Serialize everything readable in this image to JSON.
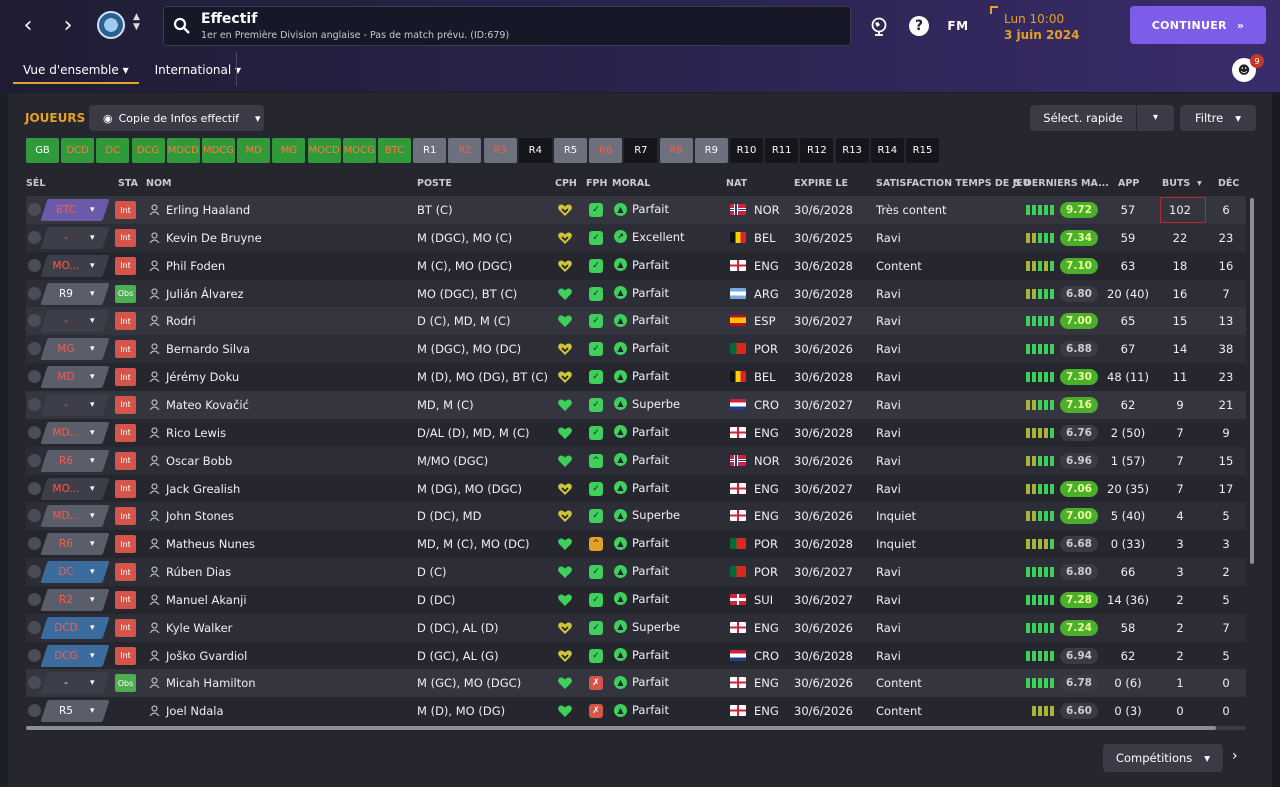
{
  "header": {
    "title": "Effectif",
    "subtitle": "1er en Première Division anglaise - Pas de match prévu. (ID:679)",
    "date_line1": "Lun 10:00",
    "date_line2": "3 juin 2024",
    "continue_label": "CONTINUER",
    "fm_label": "FM",
    "help_label": "?",
    "notif_count": "9",
    "tabs": [
      {
        "label": "Vue d'ensemble"
      },
      {
        "label": "International"
      }
    ]
  },
  "toolbar": {
    "section_label": "JOUEURS",
    "view_label": "Copie de Infos effectif",
    "quick_select": "Sélect. rapide",
    "filter": "Filtre"
  },
  "chips": [
    {
      "label": "GB",
      "style": "g"
    },
    {
      "label": "DCD",
      "style": "g o"
    },
    {
      "label": "DC",
      "style": "g o"
    },
    {
      "label": "DCG",
      "style": "g o"
    },
    {
      "label": "MDCD",
      "style": "g o"
    },
    {
      "label": "MDCG",
      "style": "g o"
    },
    {
      "label": "MD",
      "style": "g o"
    },
    {
      "label": "MG",
      "style": "g o"
    },
    {
      "label": "MOCD",
      "style": "g o"
    },
    {
      "label": "MOCG",
      "style": "g o"
    },
    {
      "label": "BTC",
      "style": "g o"
    },
    {
      "label": "R1",
      "style": "grey"
    },
    {
      "label": "R2",
      "style": "grey o"
    },
    {
      "label": "R3",
      "style": "grey o"
    },
    {
      "label": "R4",
      "style": "dark"
    },
    {
      "label": "R5",
      "style": "grey"
    },
    {
      "label": "R6",
      "style": "grey o"
    },
    {
      "label": "R7",
      "style": "dark"
    },
    {
      "label": "R8",
      "style": "grey o"
    },
    {
      "label": "R9",
      "style": "grey"
    },
    {
      "label": "R10",
      "style": "dark"
    },
    {
      "label": "R11",
      "style": "dark"
    },
    {
      "label": "R12",
      "style": "dark"
    },
    {
      "label": "R13",
      "style": "dark"
    },
    {
      "label": "R14",
      "style": "dark"
    },
    {
      "label": "R15",
      "style": "dark"
    }
  ],
  "columns": {
    "sel": "SÉL",
    "sta": "STA",
    "nom": "NOM",
    "poste": "POSTE",
    "cph": "CPH",
    "fph": "FPH",
    "moral": "MORAL",
    "nat": "NAT",
    "expire": "EXPIRE LE",
    "sat": "SATISFACTION TEMPS DE JEU",
    "form": "5 DERNIERS MA...",
    "app": "APP",
    "buts": "BUTS",
    "dec": "DÉC"
  },
  "players": [
    {
      "pos": "BTC",
      "pos_color": "#6b5aa8",
      "pos_text": "#ff5a4a",
      "sta": "Int",
      "name": "Erling Haaland",
      "poste": "BT (C)",
      "cph": "y",
      "fph": "✓",
      "fph_c": "",
      "moral_i": "▲",
      "moral": "Parfait",
      "flag": "nor",
      "nat": "NOR",
      "expire": "30/6/2028",
      "sat": "Très content",
      "form": "ggggg",
      "rating": "9.72",
      "rating_c": "gr",
      "app": "57",
      "buts": "102",
      "dec": "6"
    },
    {
      "pos": "-",
      "pos_color": "#3c3e4a",
      "pos_text": "#ff5a4a",
      "sta": "Int",
      "name": "Kevin De Bruyne",
      "poste": "M (DGC), MO (C)",
      "cph": "y",
      "fph": "✓",
      "fph_c": "",
      "moral_i": "↗",
      "moral": "Excellent",
      "flag": "bel",
      "nat": "BEL",
      "expire": "30/6/2025",
      "sat": "Ravi",
      "form": "yyggg",
      "rating": "7.34",
      "rating_c": "gr",
      "app": "59",
      "buts": "22",
      "dec": "23"
    },
    {
      "pos": "MO...",
      "pos_color": "#3c3e4a",
      "pos_text": "#ff5a4a",
      "sta": "Int",
      "name": "Phil Foden",
      "poste": "M (C), MO (DGC)",
      "cph": "y",
      "fph": "✓",
      "fph_c": "",
      "moral_i": "▲",
      "moral": "Parfait",
      "flag": "eng",
      "nat": "ENG",
      "expire": "30/6/2028",
      "sat": "Content",
      "form": "yygyg",
      "rating": "7.10",
      "rating_c": "gr",
      "app": "63",
      "buts": "18",
      "dec": "16"
    },
    {
      "pos": "R9",
      "pos_color": "#5a5d6a",
      "pos_text": "#ffffff",
      "sta": "Obs",
      "name": "Julián Álvarez",
      "poste": "MO (DGC), BT (C)",
      "cph": "g",
      "fph": "✓",
      "fph_c": "",
      "moral_i": "▲",
      "moral": "Parfait",
      "flag": "arg",
      "nat": "ARG",
      "expire": "30/6/2028",
      "sat": "Ravi",
      "form": "yyggg",
      "rating": "6.80",
      "rating_c": "gy",
      "app": "20 (40)",
      "buts": "16",
      "dec": "7"
    },
    {
      "pos": "-",
      "pos_color": "#3c3e4a",
      "pos_text": "#ff5a4a",
      "sta": "Int",
      "name": "Rodri",
      "poste": "D (C), MD, M (C)",
      "cph": "g",
      "fph": "✓",
      "fph_c": "",
      "moral_i": "▲",
      "moral": "Parfait",
      "flag": "esp",
      "nat": "ESP",
      "expire": "30/6/2027",
      "sat": "Ravi",
      "form": "ggggg",
      "rating": "7.00",
      "rating_c": "gr",
      "app": "65",
      "buts": "15",
      "dec": "13"
    },
    {
      "pos": "MG",
      "pos_color": "#5a5d6a",
      "pos_text": "#ff5a4a",
      "sta": "Int",
      "name": "Bernardo Silva",
      "poste": "M (DGC), MO (DC)",
      "cph": "y",
      "fph": "✓",
      "fph_c": "",
      "moral_i": "▲",
      "moral": "Parfait",
      "flag": "por",
      "nat": "POR",
      "expire": "30/6/2026",
      "sat": "Ravi",
      "form": "ggggg",
      "rating": "6.88",
      "rating_c": "gy",
      "app": "67",
      "buts": "14",
      "dec": "38"
    },
    {
      "pos": "MD",
      "pos_color": "#5a5d6a",
      "pos_text": "#ff5a4a",
      "sta": "Int",
      "name": "Jérémy Doku",
      "poste": "M (D), MO (DG), BT (C)",
      "cph": "y",
      "fph": "✓",
      "fph_c": "",
      "moral_i": "▲",
      "moral": "Parfait",
      "flag": "bel",
      "nat": "BEL",
      "expire": "30/6/2028",
      "sat": "Ravi",
      "form": "ggggg",
      "rating": "7.30",
      "rating_c": "gr",
      "app": "48 (11)",
      "buts": "11",
      "dec": "23"
    },
    {
      "pos": "-",
      "pos_color": "#3c3e4a",
      "pos_text": "#ff5a4a",
      "sta": "Int",
      "name": "Mateo Kovačić",
      "poste": "MD, M (C)",
      "cph": "g",
      "fph": "✓",
      "fph_c": "",
      "moral_i": "▲",
      "moral": "Superbe",
      "flag": "cro",
      "nat": "CRO",
      "expire": "30/6/2027",
      "sat": "Ravi",
      "form": "yyggg",
      "rating": "7.16",
      "rating_c": "gr",
      "app": "62",
      "buts": "9",
      "dec": "21"
    },
    {
      "pos": "MD...",
      "pos_color": "#5a5d6a",
      "pos_text": "#ff5a4a",
      "sta": "Int",
      "name": "Rico Lewis",
      "poste": "D/AL (D), MD, M (C)",
      "cph": "g",
      "fph": "✓",
      "fph_c": "",
      "moral_i": "▲",
      "moral": "Parfait",
      "flag": "eng",
      "nat": "ENG",
      "expire": "30/6/2028",
      "sat": "Ravi",
      "form": "yyyyg",
      "rating": "6.76",
      "rating_c": "gy",
      "app": "2 (50)",
      "buts": "7",
      "dec": "9"
    },
    {
      "pos": "R6",
      "pos_color": "#5a5d6a",
      "pos_text": "#ff5a4a",
      "sta": "Int",
      "name": "Oscar Bobb",
      "poste": "M/MO (DGC)",
      "cph": "g",
      "fph": "^",
      "fph_c": "",
      "moral_i": "▲",
      "moral": "Parfait",
      "flag": "nor",
      "nat": "NOR",
      "expire": "30/6/2026",
      "sat": "Ravi",
      "form": "yyggg",
      "rating": "6.96",
      "rating_c": "gy",
      "app": "1 (57)",
      "buts": "7",
      "dec": "15"
    },
    {
      "pos": "MO...",
      "pos_color": "#3c3e4a",
      "pos_text": "#ff5a4a",
      "sta": "Int",
      "name": "Jack Grealish",
      "poste": "M (DG), MO (DGC)",
      "cph": "y",
      "fph": "✓",
      "fph_c": "",
      "moral_i": "▲",
      "moral": "Parfait",
      "flag": "eng",
      "nat": "ENG",
      "expire": "30/6/2027",
      "sat": "Ravi",
      "form": "yyggg",
      "rating": "7.06",
      "rating_c": "gr",
      "app": "20 (35)",
      "buts": "7",
      "dec": "17"
    },
    {
      "pos": "MD...",
      "pos_color": "#5a5d6a",
      "pos_text": "#ff5a4a",
      "sta": "Int",
      "name": "John Stones",
      "poste": "D (DC), MD",
      "cph": "y",
      "fph": "✓",
      "fph_c": "",
      "moral_i": "▲",
      "moral": "Superbe",
      "flag": "eng",
      "nat": "ENG",
      "expire": "30/6/2026",
      "sat": "Inquiet",
      "form": "yyggg",
      "rating": "7.00",
      "rating_c": "gr",
      "app": "5 (40)",
      "buts": "4",
      "dec": "5"
    },
    {
      "pos": "R6",
      "pos_color": "#5a5d6a",
      "pos_text": "#ff5a4a",
      "sta": "Int",
      "name": "Matheus Nunes",
      "poste": "MD, M (C), MO (DC)",
      "cph": "g",
      "fph": "^",
      "fph_c": "warn",
      "moral_i": "▲",
      "moral": "Parfait",
      "flag": "por",
      "nat": "POR",
      "expire": "30/6/2028",
      "sat": "Inquiet",
      "form": "yyyyg",
      "rating": "6.68",
      "rating_c": "gy",
      "app": "0 (33)",
      "buts": "3",
      "dec": "3"
    },
    {
      "pos": "DC",
      "pos_color": "#3a6d9e",
      "pos_text": "#ff5a4a",
      "sta": "Int",
      "name": "Rúben Dias",
      "poste": "D (C)",
      "cph": "g",
      "fph": "✓",
      "fph_c": "",
      "moral_i": "▲",
      "moral": "Parfait",
      "flag": "por",
      "nat": "POR",
      "expire": "30/6/2027",
      "sat": "Ravi",
      "form": "ggggg",
      "rating": "6.80",
      "rating_c": "gy",
      "app": "66",
      "buts": "3",
      "dec": "2"
    },
    {
      "pos": "R2",
      "pos_color": "#5a5d6a",
      "pos_text": "#ff5a4a",
      "sta": "Int",
      "name": "Manuel Akanji",
      "poste": "D (DC)",
      "cph": "g",
      "fph": "✓",
      "fph_c": "",
      "moral_i": "▲",
      "moral": "Parfait",
      "flag": "sui",
      "nat": "SUI",
      "expire": "30/6/2027",
      "sat": "Ravi",
      "form": "ggggg",
      "rating": "7.28",
      "rating_c": "gr",
      "app": "14 (36)",
      "buts": "2",
      "dec": "5"
    },
    {
      "pos": "DCD",
      "pos_color": "#3a6d9e",
      "pos_text": "#ff5a4a",
      "sta": "Int",
      "name": "Kyle Walker",
      "poste": "D (DC), AL (D)",
      "cph": "y",
      "fph": "✓",
      "fph_c": "",
      "moral_i": "▲",
      "moral": "Superbe",
      "flag": "eng",
      "nat": "ENG",
      "expire": "30/6/2026",
      "sat": "Ravi",
      "form": "ggggg",
      "rating": "7.24",
      "rating_c": "gr",
      "app": "58",
      "buts": "2",
      "dec": "7"
    },
    {
      "pos": "DCG",
      "pos_color": "#3a6d9e",
      "pos_text": "#ff5a4a",
      "sta": "Int",
      "name": "Joško Gvardiol",
      "poste": "D (GC), AL (G)",
      "cph": "y",
      "fph": "✓",
      "fph_c": "",
      "moral_i": "▲",
      "moral": "Parfait",
      "flag": "cro",
      "nat": "CRO",
      "expire": "30/6/2028",
      "sat": "Ravi",
      "form": "ggggg",
      "rating": "6.94",
      "rating_c": "gy",
      "app": "62",
      "buts": "2",
      "dec": "5"
    },
    {
      "pos": "-",
      "pos_color": "#3c3e4a",
      "pos_text": "#ffffff",
      "sta": "Obs",
      "name": "Micah Hamilton",
      "poste": "M (GC), MO (DGC)",
      "cph": "g",
      "fph": "✗",
      "fph_c": "red",
      "moral_i": "▲",
      "moral": "Parfait",
      "flag": "eng",
      "nat": "ENG",
      "expire": "30/6/2026",
      "sat": "Content",
      "form": "ggggg",
      "rating": "6.78",
      "rating_c": "gy",
      "app": "0 (6)",
      "buts": "1",
      "dec": "0"
    },
    {
      "pos": "R5",
      "pos_color": "#5a5d6a",
      "pos_text": "#ffffff",
      "sta": "",
      "name": "Joel Ndala",
      "poste": "M (D), MO (DG)",
      "cph": "g",
      "fph": "✗",
      "fph_c": "red",
      "moral_i": "▲",
      "moral": "Parfait",
      "flag": "eng",
      "nat": "ENG",
      "expire": "30/6/2026",
      "sat": "Content",
      "form": "yyyy",
      "rating": "6.60",
      "rating_c": "gy",
      "app": "0 (3)",
      "buts": "0",
      "dec": "0"
    }
  ],
  "footer": {
    "competitions": "Compétitions"
  }
}
